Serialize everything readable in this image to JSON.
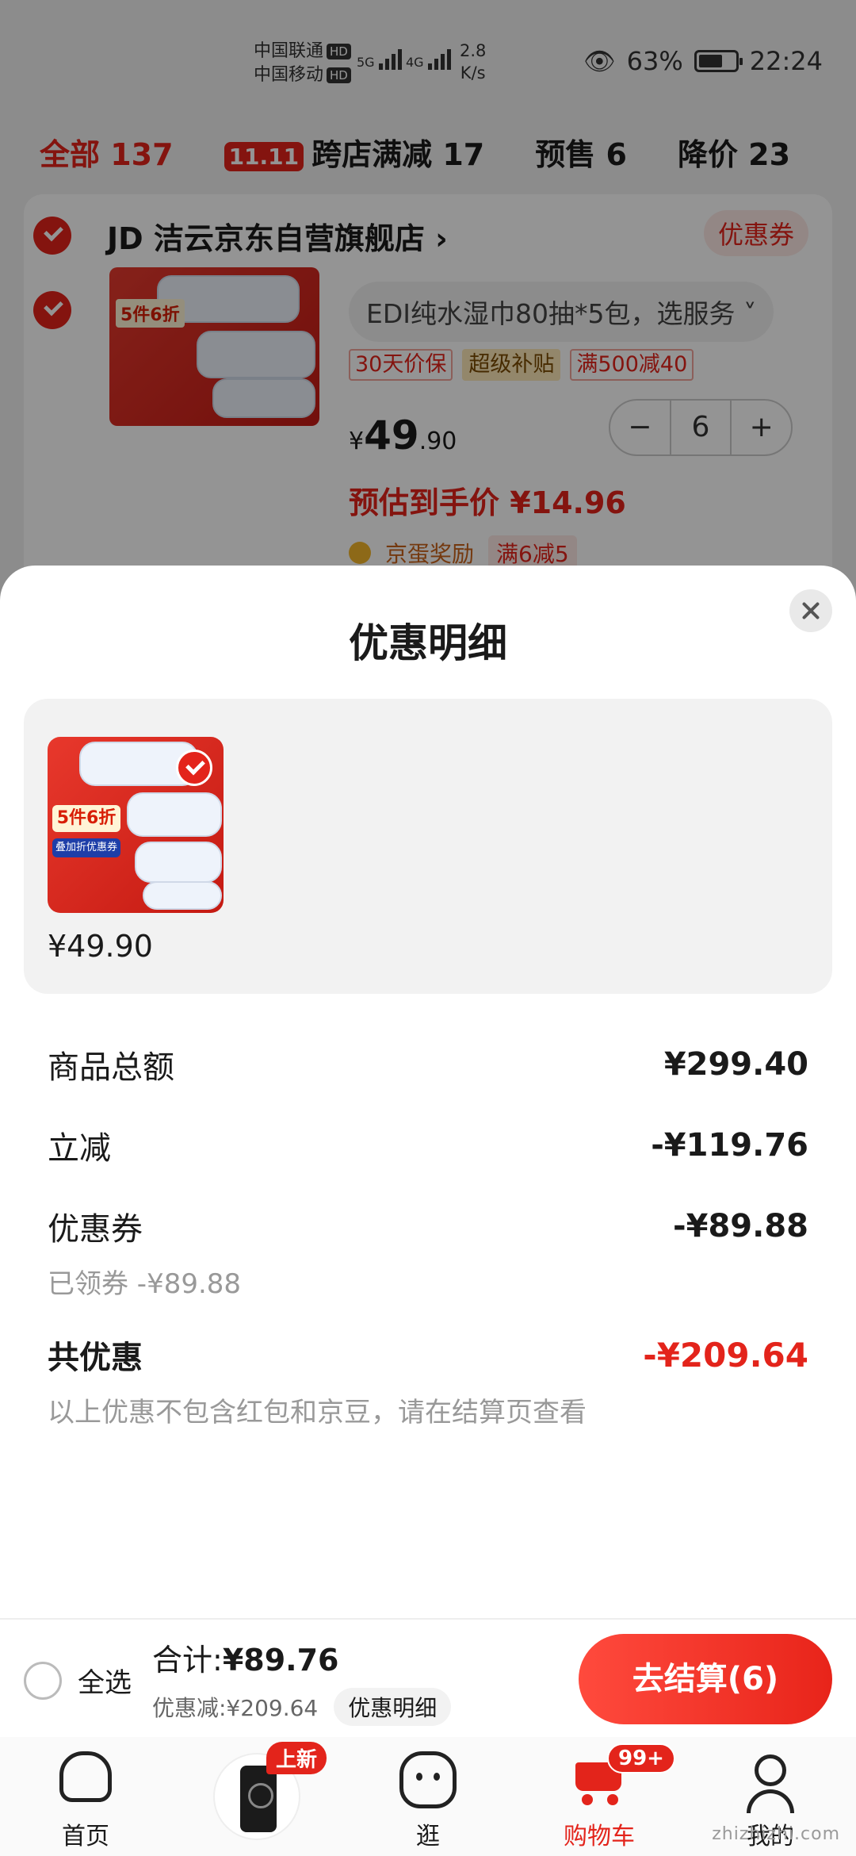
{
  "status_bar": {
    "carrier1": "中国联通",
    "carrier2": "中国移动",
    "hd": "HD",
    "net1": "5G",
    "net2": "4G",
    "speed_value": "2.8",
    "speed_unit": "K/s",
    "battery": "63%",
    "time": "22:24"
  },
  "cart_tabs": {
    "all": "全部 137",
    "cross_store_badge": "11.11",
    "cross_store": "跨店满减 17",
    "presale": "预售 6",
    "price_drop": "降价 23"
  },
  "store": {
    "name": "JD 洁云京东自营旗舰店 ›",
    "coupon": "优惠券",
    "product_spec": "EDI纯水湿巾80抽*5包，选服务 ˅",
    "tags": [
      "30天价保",
      "超级补贴",
      "满500减40"
    ],
    "price_symbol": "¥",
    "price_int": "49",
    "price_dec": ".90",
    "quantity": "6",
    "minus": "−",
    "plus": "+",
    "estimated_price": "预估到手价 ¥14.96",
    "reward_label": "京蛋奖励",
    "reward_tag": "满6减5",
    "img_label": "5件6折"
  },
  "sheet": {
    "title": "优惠明细",
    "item_price": "¥49.90",
    "thumb_promo": "5件6折",
    "thumb_promo2": "叠加折优惠券",
    "rows": {
      "goods_total_label": "商品总额",
      "goods_total_value": "¥299.40",
      "instant_off_label": "立减",
      "instant_off_value": "-¥119.76",
      "coupon_label": "优惠券",
      "coupon_value": "-¥89.88",
      "coupon_sub": "已领券 -¥89.88",
      "total_label": "共优惠",
      "total_value": "-¥209.64",
      "note": "以上优惠不包含红包和京豆，请在结算页查看"
    }
  },
  "checkout": {
    "select_all": "全选",
    "sum_label": "合计:",
    "sum_value": "¥89.76",
    "discount": "优惠减:¥209.64",
    "detail": "优惠明细",
    "button": "去结算(6)"
  },
  "tabbar": {
    "home": "首页",
    "new_badge": "上新",
    "stroll": "逛",
    "cart": "购物车",
    "cart_badge": "99+",
    "me": "我的"
  },
  "watermark": "zhizhizhi.com",
  "colors": {
    "accent": "#e3241b",
    "sheet_bg": "#ffffff",
    "panel_bg": "#f2f2f2"
  }
}
